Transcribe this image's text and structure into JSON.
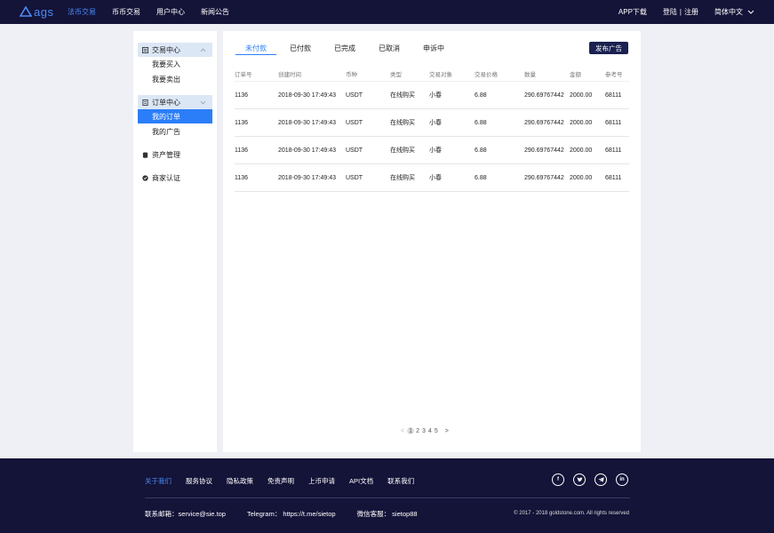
{
  "header": {
    "logo_text": "ags",
    "nav": [
      "法币交易",
      "币币交易",
      "用户中心",
      "新闻公告"
    ],
    "app_download": "APP下载",
    "login": "登陆",
    "separator": "|",
    "register": "注册",
    "language": "简体中文"
  },
  "sidebar": {
    "trade_center": "交易中心",
    "buy": "我要买入",
    "sell": "我要卖出",
    "order_center": "订单中心",
    "my_orders": "我的订单",
    "my_ads": "我的广告",
    "assets": "资产管理",
    "merchant": "商家认证"
  },
  "main": {
    "tabs": [
      "未付款",
      "已付款",
      "已完成",
      "已取消",
      "申诉中"
    ],
    "publish_button": "发布广告",
    "columns": [
      "订单号",
      "创建时间",
      "币种",
      "类型",
      "交易对象",
      "交易价格",
      "数量",
      "金额",
      "参考号"
    ],
    "rows": [
      [
        "1136",
        "2018-09-30 17:49:43",
        "USDT",
        "在线购买",
        "小春",
        "6.88",
        "290.69767442",
        "2000.00",
        "68111"
      ],
      [
        "1136",
        "2018-09-30 17:49:43",
        "USDT",
        "在线购买",
        "小春",
        "6.88",
        "290.69767442",
        "2000.00",
        "68111"
      ],
      [
        "1136",
        "2018-09-30 17:49:43",
        "USDT",
        "在线购买",
        "小春",
        "6.88",
        "290.69767442",
        "2000.00",
        "68111"
      ],
      [
        "1136",
        "2018-09-30 17:49:43",
        "USDT",
        "在线购买",
        "小春",
        "6.88",
        "290.69767442",
        "2000.00",
        "68111"
      ]
    ],
    "pagination": {
      "prev": "<",
      "current": "1",
      "pages": [
        "2",
        "3",
        "4",
        "5"
      ],
      "next": ">"
    }
  },
  "footer": {
    "links": [
      "关于我们",
      "服务协议",
      "隐私政策",
      "免责声明",
      "上币申请",
      "API文档",
      "联系我们"
    ],
    "social_icons": [
      "facebook-icon",
      "twitter-icon",
      "telegram-icon",
      "linkedin-icon"
    ],
    "email": "联系邮箱：service@sie.top",
    "telegram": "Telegram：  https://t.me/sietop",
    "wechat": "微信客服：  sietop88",
    "copyright": "© 2017 - 2018 goldstone.com. All rights reserved"
  },
  "colors": {
    "header_bg": "#141338",
    "accent": "#2b7ef8",
    "page_bg": "#eff0f5",
    "button_bg": "#1b2150"
  }
}
